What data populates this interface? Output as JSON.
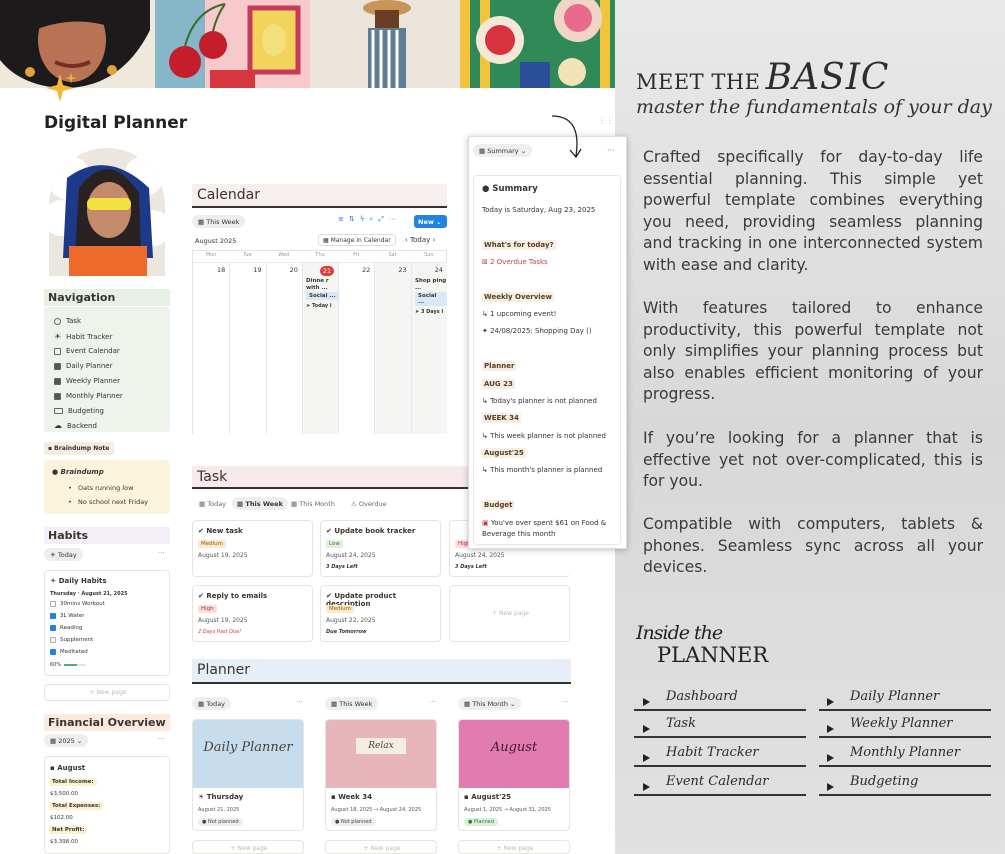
{
  "left": {
    "title": "Digital Planner",
    "nav": {
      "heading": "Navigation",
      "items": [
        "Task",
        "Habit Tracker",
        "Event Calendar",
        "Daily Planner",
        "Weekly Planner",
        "Monthly Planner",
        "Budgeting",
        "Backend"
      ]
    },
    "braindump": {
      "chip": "Braindump Note",
      "title": "Braindump",
      "bullets": [
        "Oats running low",
        "No school next Friday"
      ]
    },
    "habits": {
      "heading": "Habits",
      "view": "Today",
      "card_title": "Daily Habits",
      "date": "Thursday · August 21, 2025",
      "items": [
        {
          "label": "30mins Workout",
          "checked": false
        },
        {
          "label": "3L Water",
          "checked": true
        },
        {
          "label": "Reading",
          "checked": true
        },
        {
          "label": "Supplement",
          "checked": false
        },
        {
          "label": "Meditated",
          "checked": true
        }
      ],
      "progress_text": "60%",
      "progress": 0.6,
      "new_page": "+ New page"
    },
    "financial": {
      "heading": "Financial Overview",
      "year": "2025",
      "month": "August",
      "income_label": "Total Income:",
      "income": "$3,500.00",
      "expenses_label": "Total Expenses:",
      "expenses": "$102.00",
      "net_label": "Net Profit:",
      "net": "$3,398.00"
    }
  },
  "calendar": {
    "heading": "Calendar",
    "view": "This Week",
    "new": "New",
    "month": "August 2025",
    "manage": "Manage in Calendar",
    "today": "Today",
    "weekdays": [
      "Mon",
      "Tue",
      "Wed",
      "Thu",
      "Fri",
      "Sat",
      "Sun"
    ],
    "days": [
      "18",
      "19",
      "20",
      "21",
      "22",
      "23",
      "24"
    ],
    "event1": {
      "title": "Dinne r with ...",
      "tag": "Social ...",
      "sub": "Today i"
    },
    "event2": {
      "title": "Shop ping ...",
      "tag": "Social ...",
      "sub": "3 Days l"
    }
  },
  "task": {
    "heading": "Task",
    "tabs": [
      "Today",
      "This Week",
      "This Month",
      "Overdue"
    ],
    "cards": [
      {
        "title": "New task",
        "tag": "Medium",
        "date": "August 19, 2025",
        "note": ""
      },
      {
        "title": "Update book tracker",
        "tag": "Low",
        "date": "August 24, 2025",
        "note": "3 Days Left"
      },
      {
        "title": "Reply to emails",
        "tag": "High",
        "date": "August 19, 2025",
        "note": "2 Days Past Due!"
      },
      {
        "title": "Update product description",
        "tag": "Medium",
        "date": "August 22, 2025",
        "note": "Due Tomorrow"
      }
    ],
    "partial_tag": "High",
    "partial_date": "August 24, 2025",
    "partial_note": "3 Days Left",
    "new_page": "+ New page"
  },
  "planner": {
    "heading": "Planner",
    "columns": [
      {
        "view": "Today",
        "img": "Daily Planner",
        "title": "Thursday",
        "date": "August 21, 2025",
        "status": "Not planned"
      },
      {
        "view": "This Week",
        "img": "Relax",
        "title": "Week 34",
        "date": "August 18, 2025 → August 24, 2025",
        "status": "Not planned"
      },
      {
        "view": "This Month",
        "img": "August",
        "title": "August'25",
        "date": "August 1, 2025 → August 31, 2025",
        "status": "Planned"
      }
    ],
    "new_page": "+ New page"
  },
  "summary": {
    "view": "Summary",
    "title": "Summary",
    "today_line": "Today is Saturday, Aug 23, 2025",
    "whats_today": "What's for today?",
    "overdue": "⊠ 2 Overdue Tasks",
    "weekly": "Weekly Overview",
    "upcoming": "↳ 1 upcoming event!",
    "event": "✦ 24/08/2025: Shopping Day ()",
    "planner": "Planner",
    "aug23": "AUG 23",
    "aug23_note": "↳ Today's planner is not planned",
    "week34": "WEEK 34",
    "week34_note": "↳ This week planner is not planned",
    "aug25": "August'25",
    "aug25_note": "↳ This month's planner is planned",
    "budget": "Budget",
    "budget_note": "You've over spent $61 on Food & Beverage this month"
  },
  "right": {
    "meet": "MEET THE",
    "basic": "BASIC",
    "tagline": "master the fundamentals of your day",
    "p1": "Crafted specifically for day-to-day life essential planning. This simple yet powerful template combines everything you need, providing seamless planning and tracking in one interconnected system with ease and clarity.",
    "p2": "With features tailored to enhance productivity, this powerful template not only simplifies your planning process but also enables efficient monitoring of your progress.",
    "p3": "If you’re looking for a planner that is effective yet not over-complicated, this is for you.",
    "p4": "Compatible with computers, tablets & phones. Seamless sync across all your devices.",
    "inside": "Inside the",
    "planner_word": "PLANNER",
    "links_left": [
      "Dashboard",
      "Task",
      "Habit Tracker",
      "Event Calendar"
    ],
    "links_right": [
      "Daily Planner",
      "Weekly Planner",
      "Monthly Planner",
      "Budgeting"
    ]
  }
}
